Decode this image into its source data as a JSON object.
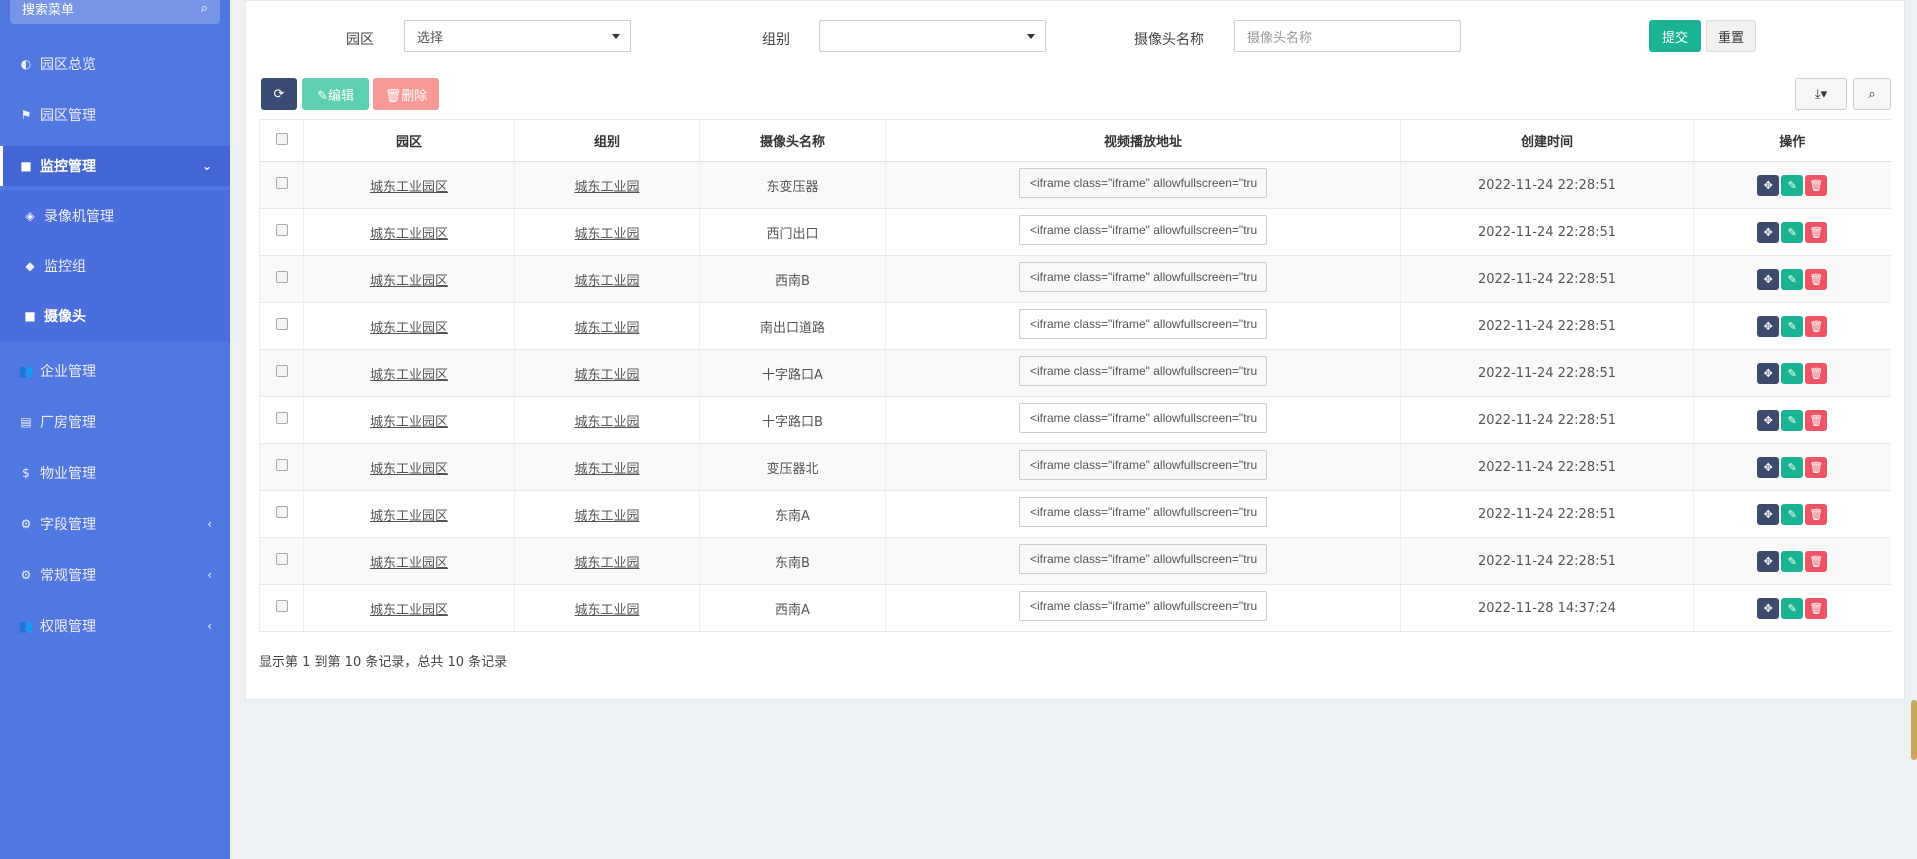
{
  "sidebar": {
    "search_placeholder": "搜索菜单",
    "items": [
      {
        "label": "园区总览",
        "icon": "◐"
      },
      {
        "label": "园区管理",
        "icon": "⚑"
      },
      {
        "label": "监控管理",
        "icon": "■"
      },
      {
        "label": "企业管理",
        "icon": "👥"
      },
      {
        "label": "厂房管理",
        "icon": "▤"
      },
      {
        "label": "物业管理",
        "icon": "$"
      },
      {
        "label": "字段管理",
        "icon": "⚙"
      },
      {
        "label": "常规管理",
        "icon": "⚙"
      },
      {
        "label": "权限管理",
        "icon": "👥"
      }
    ],
    "sub_items": [
      {
        "label": "录像机管理",
        "icon": "◈"
      },
      {
        "label": "监控组",
        "icon": "◆"
      },
      {
        "label": "摄像头",
        "icon": "■"
      }
    ]
  },
  "filters": {
    "park_label": "园区",
    "park_value": "选择",
    "group_label": "组别",
    "group_value": "",
    "camera_label": "摄像头名称",
    "camera_placeholder": "摄像头名称",
    "submit": "提交",
    "reset": "重置"
  },
  "toolbar": {
    "refresh_icon": "⟳",
    "edit": "✎编辑",
    "delete": "🗑删除",
    "export_icon": "⤓▾",
    "search_icon": "⌕"
  },
  "table": {
    "headers": [
      "园区",
      "组别",
      "摄像头名称",
      "视频播放地址",
      "创建时间",
      "操作"
    ],
    "rows": [
      {
        "park": "城东工业园区",
        "group": "城东工业园",
        "name": "东变压器",
        "url": "<iframe class=\"iframe\" allowfullscreen=\"tru",
        "time": "2022-11-24 22:28:51"
      },
      {
        "park": "城东工业园区",
        "group": "城东工业园",
        "name": "西门出口",
        "url": "<iframe class=\"iframe\" allowfullscreen=\"tru",
        "time": "2022-11-24 22:28:51"
      },
      {
        "park": "城东工业园区",
        "group": "城东工业园",
        "name": "西南B",
        "url": "<iframe class=\"iframe\" allowfullscreen=\"tru",
        "time": "2022-11-24 22:28:51"
      },
      {
        "park": "城东工业园区",
        "group": "城东工业园",
        "name": "南出口道路",
        "url": "<iframe class=\"iframe\" allowfullscreen=\"tru",
        "time": "2022-11-24 22:28:51"
      },
      {
        "park": "城东工业园区",
        "group": "城东工业园",
        "name": "十字路口A",
        "url": "<iframe class=\"iframe\" allowfullscreen=\"tru",
        "time": "2022-11-24 22:28:51"
      },
      {
        "park": "城东工业园区",
        "group": "城东工业园",
        "name": "十字路口B",
        "url": "<iframe class=\"iframe\" allowfullscreen=\"tru",
        "time": "2022-11-24 22:28:51"
      },
      {
        "park": "城东工业园区",
        "group": "城东工业园",
        "name": "变压器北",
        "url": "<iframe class=\"iframe\" allowfullscreen=\"tru",
        "time": "2022-11-24 22:28:51"
      },
      {
        "park": "城东工业园区",
        "group": "城东工业园",
        "name": "东南A",
        "url": "<iframe class=\"iframe\" allowfullscreen=\"tru",
        "time": "2022-11-24 22:28:51"
      },
      {
        "park": "城东工业园区",
        "group": "城东工业园",
        "name": "东南B",
        "url": "<iframe class=\"iframe\" allowfullscreen=\"tru",
        "time": "2022-11-24 22:28:51"
      },
      {
        "park": "城东工业园区",
        "group": "城东工业园",
        "name": "西南A",
        "url": "<iframe class=\"iframe\" allowfullscreen=\"tru",
        "time": "2022-11-28 14:37:24"
      }
    ],
    "action_icons": {
      "move": "✥",
      "edit": "✎",
      "delete": "🗑"
    }
  },
  "pagination": {
    "info": "显示第 1 到第 10 条记录，总共 10 条记录"
  }
}
